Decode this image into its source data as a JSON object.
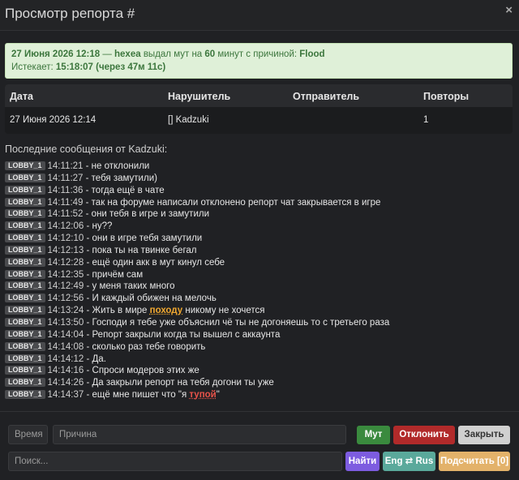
{
  "window": {
    "title": "Просмотр репорта #",
    "close_glyph": "×"
  },
  "notice": {
    "date": "27 Июня 2026 12:18",
    "dash": " — ",
    "user": "hexea",
    "mid1": " выдал мут на ",
    "minutes": "60",
    "mid2": " минут с причиной: ",
    "reason": "Flood",
    "expires_label": "Истекает: ",
    "expires_value": "15:18:07 (через 47м 11с)"
  },
  "table": {
    "headers": [
      "Дата",
      "Нарушитель",
      "Отправитель",
      "Повторы"
    ],
    "row": {
      "date": "27 Июня 2026 12:14",
      "offender": "[] Kadzuki",
      "sender": "",
      "repeats": "1"
    }
  },
  "messages_title": "Последние сообщения от Kadzuki:",
  "messages": [
    {
      "tag": "LOBBY_1",
      "time": "14:11:21",
      "text": "не отклонили"
    },
    {
      "tag": "LOBBY_1",
      "time": "14:11:27",
      "text": "тебя замутили)"
    },
    {
      "tag": "LOBBY_1",
      "time": "14:11:36",
      "text": "тогда ещё в чате"
    },
    {
      "tag": "LOBBY_1",
      "time": "14:11:49",
      "text": "так на форуме написали отклонено репорт чат закрывается в игре"
    },
    {
      "tag": "LOBBY_1",
      "time": "14:11:52",
      "text": "они тебя в игре и замутили"
    },
    {
      "tag": "LOBBY_1",
      "time": "14:12:06",
      "text": "ну??"
    },
    {
      "tag": "LOBBY_1",
      "time": "14:12:10",
      "text": "они в игре тебя замутили"
    },
    {
      "tag": "LOBBY_1",
      "time": "14:12:13",
      "text": "пока ты на твинке бегал"
    },
    {
      "tag": "LOBBY_1",
      "time": "14:12:28",
      "text": "ещё один акк в мут кинул себе"
    },
    {
      "tag": "LOBBY_1",
      "time": "14:12:35",
      "text": "причём сам"
    },
    {
      "tag": "LOBBY_1",
      "time": "14:12:49",
      "text": "у меня таких много"
    },
    {
      "tag": "LOBBY_1",
      "time": "14:12:56",
      "text": "И каждый обижен на мелочь"
    },
    {
      "tag": "LOBBY_1",
      "time": "14:13:24",
      "text_before": "Жить в мире ",
      "highlight": "походу",
      "highlight_color": "orange",
      "text_after": " никому не хочется"
    },
    {
      "tag": "LOBBY_1",
      "time": "14:13:50",
      "text": "Господи я тебе уже объяснил чё ты не догоняешь то с третьего раза"
    },
    {
      "tag": "LOBBY_1",
      "time": "14:14:04",
      "text": "Репорт закрыли когда ты вышел с аккаунта"
    },
    {
      "tag": "LOBBY_1",
      "time": "14:14:08",
      "text": "сколько раз тебе говорить"
    },
    {
      "tag": "LOBBY_1",
      "time": "14:14:12",
      "text": "Да."
    },
    {
      "tag": "LOBBY_1",
      "time": "14:14:16",
      "text": "Спроси модеров этих же"
    },
    {
      "tag": "LOBBY_1",
      "time": "14:14:26",
      "text": "Да закрыли репорт на тебя догони ты уже"
    },
    {
      "tag": "LOBBY_1",
      "time": "14:14:37",
      "text_before": "ещё мне пишет что \"я ",
      "highlight": "тупой",
      "highlight_color": "red",
      "text_after": "\""
    }
  ],
  "controls": {
    "time_placeholder": "Время",
    "reason_placeholder": "Причина",
    "mute_label": "Мут",
    "reject_label": "Отклонить",
    "close_label": "Закрыть",
    "search_placeholder": "Поиск...",
    "find_label": "Найти",
    "translit_label": "Eng ⇄ Rus",
    "count_label": "Подсчитать [0]"
  },
  "colors": {
    "background": "#202124",
    "notice_bg": "#dff0d8",
    "notice_text": "#3c763d",
    "mute_btn": "#3a8a3e",
    "reject_btn": "#b12a2a",
    "close_btn": "#d0d0d0",
    "find_btn": "#7d5ce0",
    "translit_btn": "#5aa99b",
    "count_btn": "#e3b26a",
    "highlight_orange": "#f0a830",
    "highlight_red": "#e8534a"
  }
}
